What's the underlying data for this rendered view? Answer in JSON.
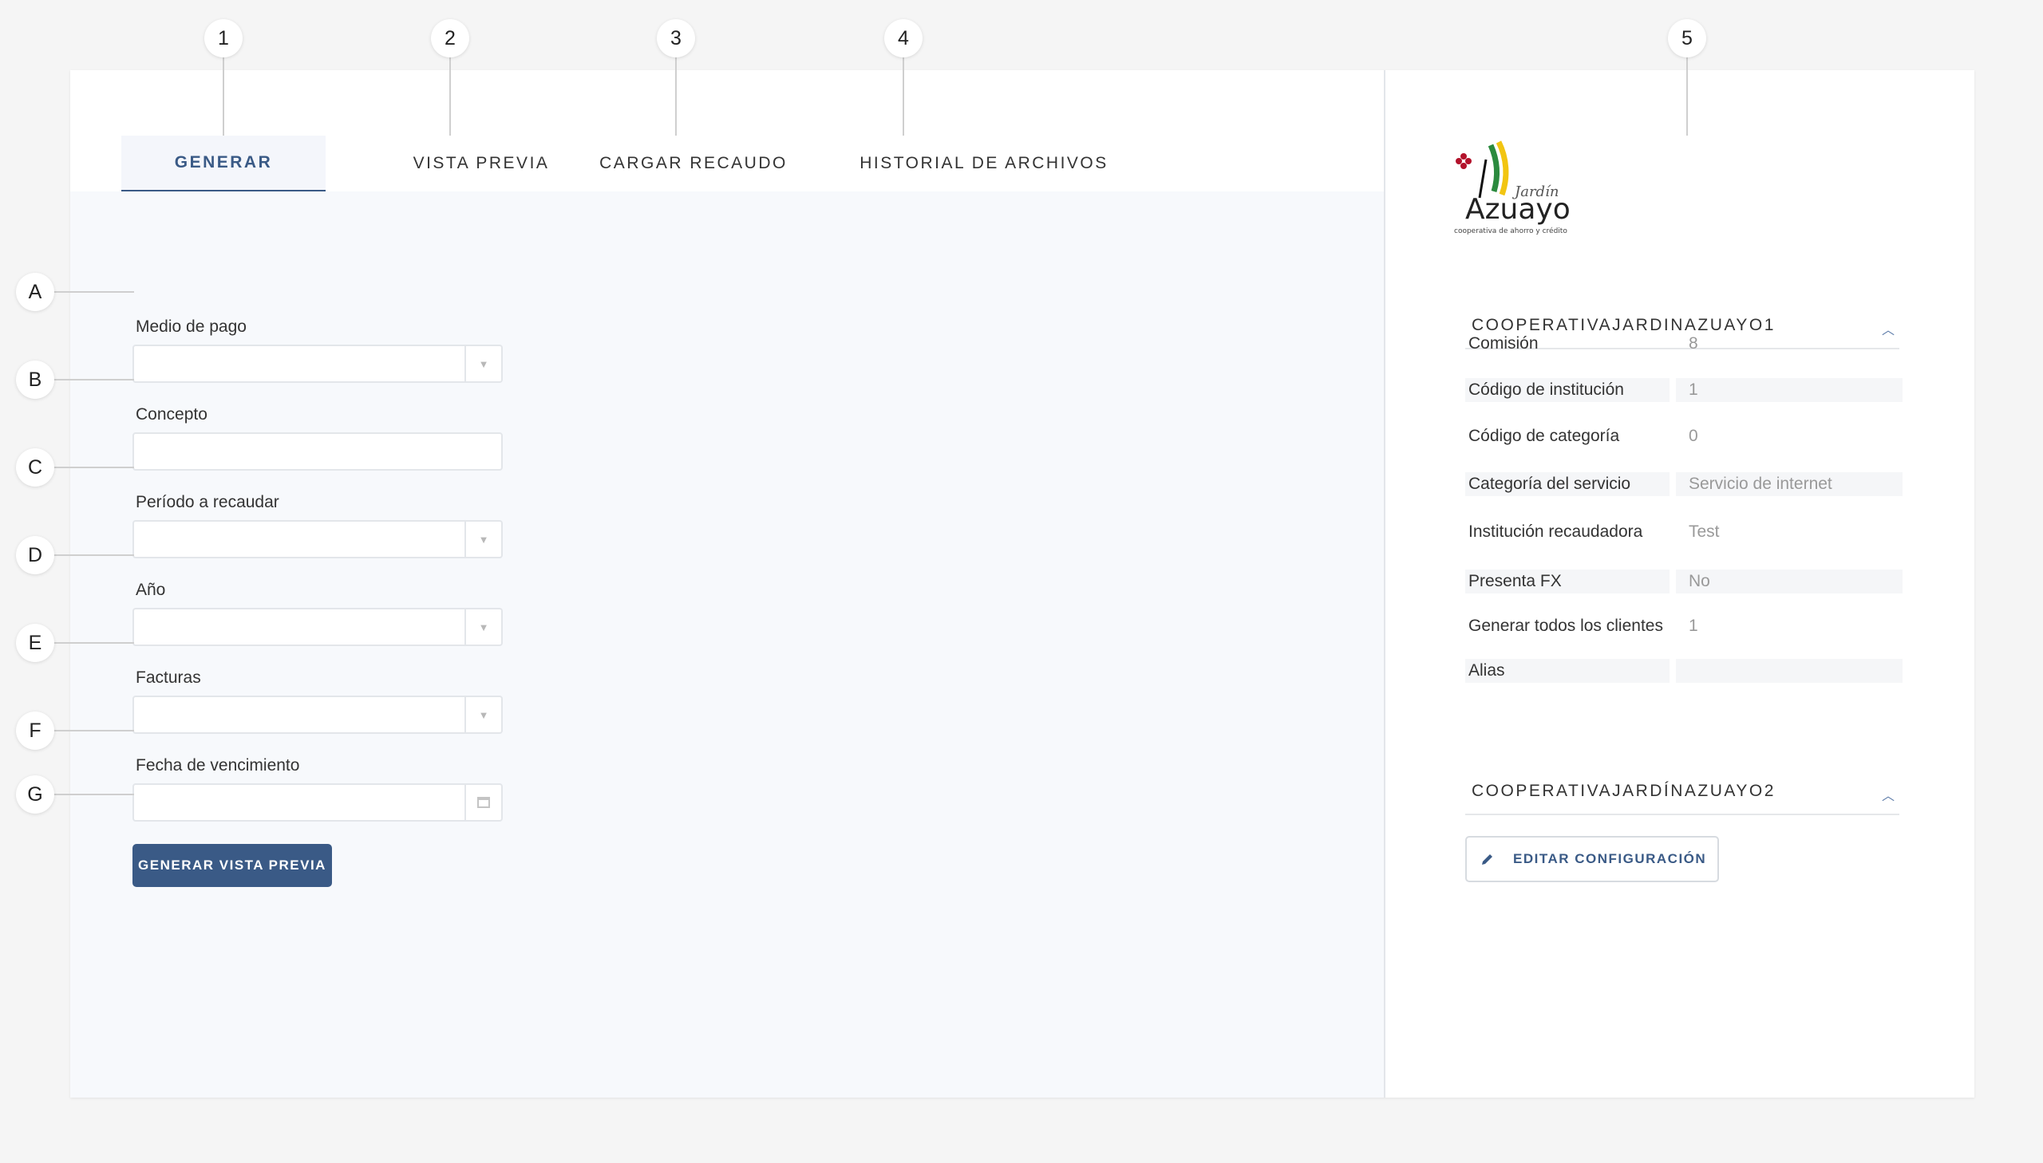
{
  "callouts": {
    "tabs": [
      "1",
      "2",
      "3",
      "4",
      "5"
    ],
    "fields": [
      "A",
      "B",
      "C",
      "D",
      "E",
      "F",
      "G"
    ]
  },
  "tabs": [
    {
      "label": "GENERAR",
      "active": true
    },
    {
      "label": "VISTA PREVIA",
      "active": false
    },
    {
      "label": "CARGAR RECAUDO",
      "active": false
    },
    {
      "label": "HISTORIAL DE ARCHIVOS",
      "active": false
    }
  ],
  "form": {
    "medio_de_pago": {
      "label": "Medio de pago",
      "value": ""
    },
    "concepto": {
      "label": "Concepto",
      "value": ""
    },
    "periodo": {
      "label": "Período a recaudar",
      "value": ""
    },
    "anio": {
      "label": "Año",
      "value": ""
    },
    "facturas": {
      "label": "Facturas",
      "value": ""
    },
    "fecha_vencimiento": {
      "label": "Fecha de vencimiento",
      "value": ""
    },
    "submit_label": "GENERAR VISTA PREVIA"
  },
  "logo": {
    "name": "Jardín Azuayo",
    "line1": "Jardín",
    "line2": "Azuayo",
    "tagline": "cooperativa de ahorro y crédito"
  },
  "sections": [
    {
      "title": "COOPERATIVAJARDINAZUAYO1",
      "expanded": true,
      "properties": [
        {
          "key": "Comisión",
          "value": "8"
        },
        {
          "key": "Código de institución",
          "value": "1"
        },
        {
          "key": "Código de categoría",
          "value": "0"
        },
        {
          "key": "Categoría del servicio",
          "value": "Servicio de internet"
        },
        {
          "key": "Institución recaudadora",
          "value": "Test"
        },
        {
          "key": "Presenta FX",
          "value": "No"
        },
        {
          "key": "Generar todos los clientes",
          "value": "1"
        },
        {
          "key": "Alias",
          "value": ""
        }
      ]
    },
    {
      "title": "COOPERATIVAJARDÍNAZUAYO2",
      "expanded": true,
      "properties": []
    }
  ],
  "edit_button_label": "EDITAR CONFIGURACIÓN",
  "icons": {
    "dropdown": "caret-down-icon",
    "date": "calendar-icon",
    "collapse": "chevron-up-icon",
    "edit": "pencil-icon"
  },
  "colors": {
    "primary": "#3a5a86",
    "background": "#f5f5f5",
    "form_background": "#f7f9fc",
    "card": "#ffffff"
  }
}
